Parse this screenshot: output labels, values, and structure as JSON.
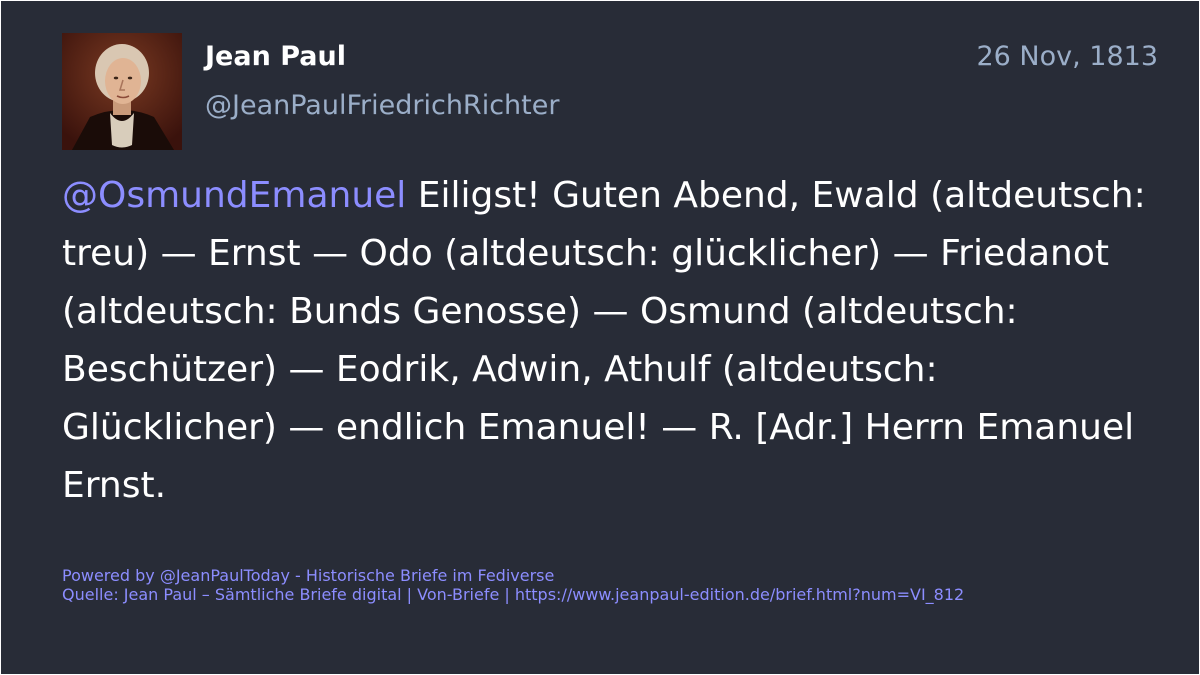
{
  "post": {
    "author_name": "Jean Paul",
    "author_handle": "@JeanPaulFriedrichRichter",
    "date": "26 Nov, 1813",
    "mention": "@OsmundEmanuel",
    "text": " Eiligst! Guten Abend, Ewald (altdeutsch: treu) — Ernst — Odo (altdeutsch: glücklicher) — Friedanot (altdeutsch: Bunds Genosse) — Osmund (altdeutsch: Beschützer) — Eodrik, Adwin, Athulf (altdeutsch: Glücklicher) — endlich Emanuel! — R. [Adr.] Herrn Emanuel Ernst."
  },
  "footer": {
    "powered_by": "Powered by @JeanPaulToday - Historische Briefe im Fediverse",
    "source": "Quelle: Jean Paul – Sämtliche Briefe digital | Von-Briefe | https://www.jeanpaul-edition.de/brief.html?num=VI_812"
  },
  "colors": {
    "background": "#282c37",
    "name": "#ffffff",
    "secondary": "#9baec8",
    "accent": "#8c8dff"
  },
  "icons": {
    "avatar": "portrait-avatar"
  }
}
